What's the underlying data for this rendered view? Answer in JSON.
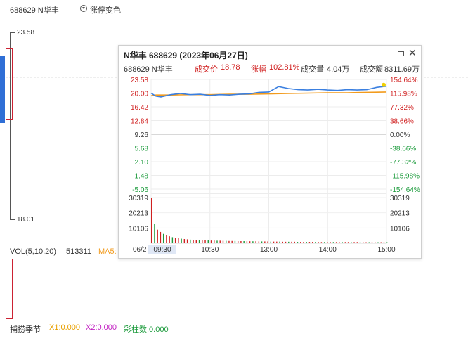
{
  "header": {
    "stock": "688629 N华丰",
    "toggle_label": "涨停变色"
  },
  "main_chart": {
    "high_label": "23.58",
    "low_label": "18.01"
  },
  "vol_panel": {
    "label": "VOL(5,10,20)",
    "value": "513311",
    "ma_label": "MA5:"
  },
  "bottom_bar": {
    "label": "捕捞季节",
    "x1": "X1:0.000",
    "x2": "X2:0.000",
    "bars": "彩柱数:0.000"
  },
  "popup": {
    "title": "N华丰  688629  (2023年06月27日)",
    "code_name": "688629 N华丰",
    "price_label": "成交价",
    "price": "18.78",
    "change_label": "涨幅",
    "change": "102.81%",
    "volume_label": "成交量",
    "volume": "4.04万",
    "amount_label": "成交额",
    "amount": "8311.69万"
  },
  "colors": {
    "price_line": "#3a7fe0",
    "avg_line": "#f29b1d",
    "up": "#d02020",
    "down": "#1a9a3a",
    "accent": "#2f6fd6"
  },
  "chart_data": {
    "type": "line",
    "x_ticks": [
      "09:30",
      "10:30",
      "13:00",
      "14:00",
      "15:00"
    ],
    "date_label": "06/27",
    "left_ticks": [
      "23.58",
      "20.00",
      "16.42",
      "12.84",
      "9.26",
      "5.68",
      "2.10",
      "-1.48",
      "-5.06"
    ],
    "right_ticks": [
      "154.64%",
      "115.98%",
      "77.32%",
      "38.66%",
      "0.00%",
      "-38.66%",
      "-77.32%",
      "-115.98%",
      "-154.64%"
    ],
    "ylim": [
      -5.06,
      23.58
    ],
    "vol_ticks": [
      "30319",
      "20213",
      "10106"
    ],
    "vol_right_ticks": [
      "30319",
      "20213",
      "10106"
    ],
    "series": [
      {
        "x": [
          0,
          5,
          10,
          20,
          30,
          40,
          50,
          60,
          70,
          80,
          90,
          100,
          110,
          120,
          130,
          140,
          150,
          160,
          170,
          180,
          190,
          200,
          210,
          220,
          230,
          240
        ],
        "values": [
          20.0,
          19.2,
          19.0,
          19.6,
          19.9,
          19.6,
          19.7,
          19.4,
          19.6,
          19.5,
          19.7,
          19.8,
          20.2,
          20.3,
          21.7,
          21.2,
          20.9,
          20.8,
          21.0,
          20.8,
          20.7,
          20.9,
          20.8,
          20.9,
          21.5,
          21.8
        ]
      },
      {
        "x": [
          0,
          5,
          10,
          20,
          40,
          60,
          80,
          100,
          120,
          140,
          160,
          180,
          200,
          220,
          240
        ],
        "values": [
          19.3,
          19.5,
          19.5,
          19.5,
          19.6,
          19.6,
          19.7,
          19.7,
          19.8,
          19.9,
          20.0,
          20.1,
          20.1,
          20.2,
          20.3
        ]
      }
    ],
    "volume": [
      30319,
      13000,
      9000,
      7500,
      6200,
      5200,
      4600,
      4000,
      3600,
      3300,
      3000,
      2800,
      2600,
      2400,
      2300,
      2200,
      2100,
      2000,
      1900,
      1900,
      1800,
      1800,
      1700,
      1700,
      1600,
      1600,
      1500,
      1500,
      1500,
      1400,
      1400,
      1400,
      1300,
      1300,
      1300,
      1300,
      1200,
      1200,
      1200,
      1200,
      1100,
      1100,
      1100,
      1100,
      1000,
      1000,
      1000,
      1000,
      1000,
      900,
      900,
      900,
      900,
      900,
      900,
      900,
      800,
      800,
      800,
      800,
      800,
      800,
      800,
      800,
      800,
      800,
      800,
      800,
      800,
      800,
      700,
      700,
      700,
      700,
      700,
      700,
      700,
      700,
      700,
      700
    ]
  }
}
